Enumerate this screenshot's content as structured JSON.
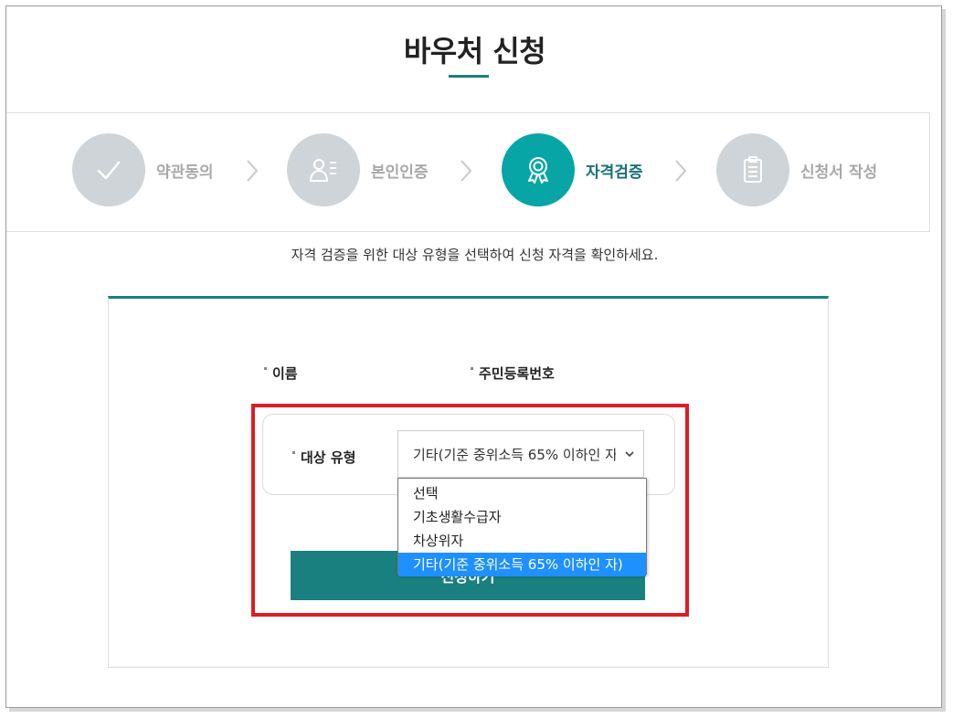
{
  "page": {
    "title": "바우처 신청",
    "guide": "자격 검증을 위한 대상 유형을 선택하여 신청 자격을 확인하세요."
  },
  "steps": [
    {
      "label": "약관동의",
      "icon": "check-icon",
      "active": false
    },
    {
      "label": "본인인증",
      "icon": "user-id-icon",
      "active": false
    },
    {
      "label": "자격검증",
      "icon": "award-icon",
      "active": true
    },
    {
      "label": "신청서 작성",
      "icon": "clipboard-icon",
      "active": false
    }
  ],
  "form": {
    "name_label": "이름",
    "rrn_label": "주민등록번호",
    "type_label": "대상 유형",
    "type_select_value": "기타(기준 중위소득 65% 이하인 자)",
    "type_options": [
      "선택",
      "기초생활수급자",
      "차상위자",
      "기타(기준 중위소득 65% 이하인 자)"
    ],
    "selected_index": 3,
    "submit_label": "신청하기"
  },
  "colors": {
    "accent": "#1a7f7f",
    "active_step": "#07a5a5",
    "inactive_step": "#cfd4d8",
    "highlight_border": "#e01b24",
    "option_selected": "#1e90ff"
  }
}
